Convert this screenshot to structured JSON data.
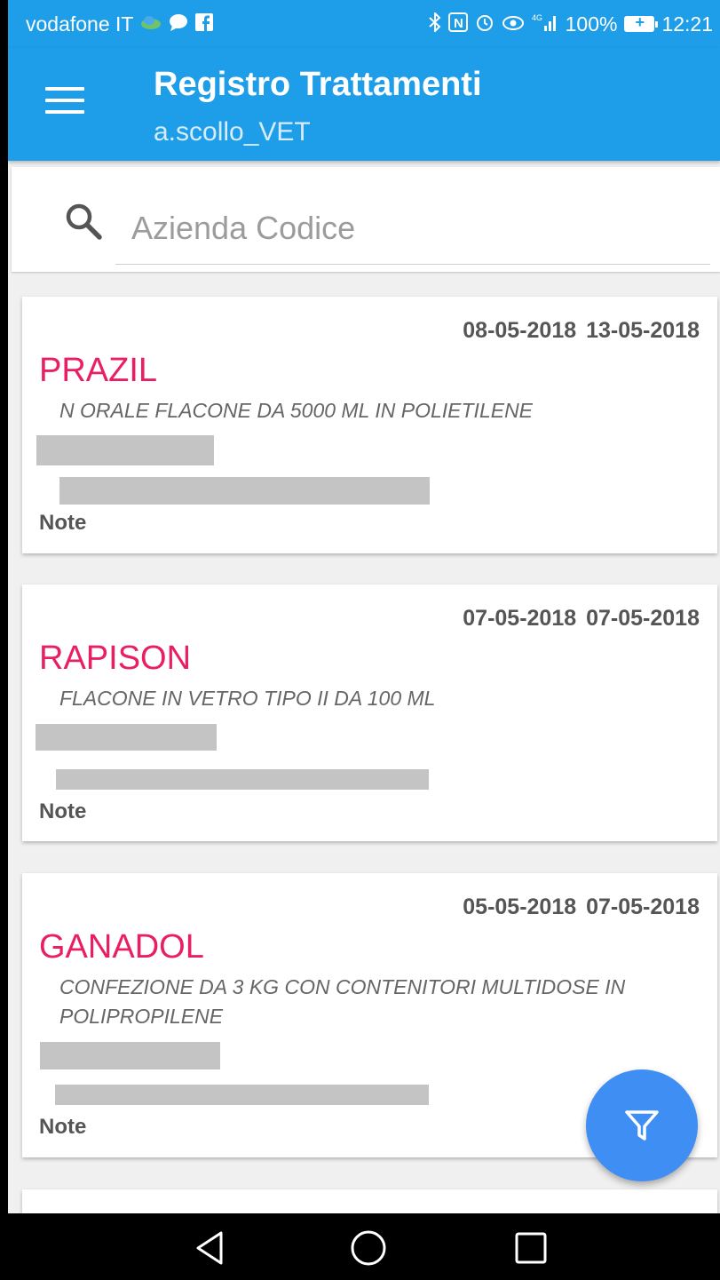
{
  "status_bar": {
    "carrier": "vodafone IT",
    "battery": "100%",
    "time": "12:21",
    "network": "4G",
    "icons": [
      "cloud-icon",
      "chat-icon",
      "facebook-icon",
      "bluetooth-icon",
      "nfc-icon",
      "alarm-icon",
      "eye-icon",
      "signal-icon",
      "battery-icon"
    ]
  },
  "toolbar": {
    "title": "Registro Trattamenti",
    "subtitle": "a.scollo_VET",
    "menu_icon": "hamburger-menu-icon"
  },
  "search": {
    "placeholder": "Azienda Codice",
    "value": "",
    "icon": "search-icon"
  },
  "treatments": [
    {
      "date_start": "08-05-2018",
      "date_end": "13-05-2018",
      "name": "PRAZIL",
      "description": "N ORALE FLACONE DA 5000 ML IN POLIETILENE",
      "note_label": "Note"
    },
    {
      "date_start": "07-05-2018",
      "date_end": "07-05-2018",
      "name": "RAPISON",
      "description": "FLACONE IN VETRO TIPO II DA 100 ML",
      "note_label": "Note"
    },
    {
      "date_start": "05-05-2018",
      "date_end": "07-05-2018",
      "name": "GANADOL",
      "description": "CONFEZIONE DA 3 KG CON CONTENITORI MULTIDOSE IN POLIPROPILENE",
      "note_label": "Note"
    }
  ],
  "fab": {
    "icon": "filter-icon"
  },
  "nav_bar": {
    "icons": [
      "back-triangle-icon",
      "home-circle-icon",
      "recents-square-icon"
    ]
  },
  "colors": {
    "primary": "#1e9ee9",
    "accent": "#e91e63",
    "fab": "#3f8ef3",
    "redaction": "#c4c4c4"
  }
}
